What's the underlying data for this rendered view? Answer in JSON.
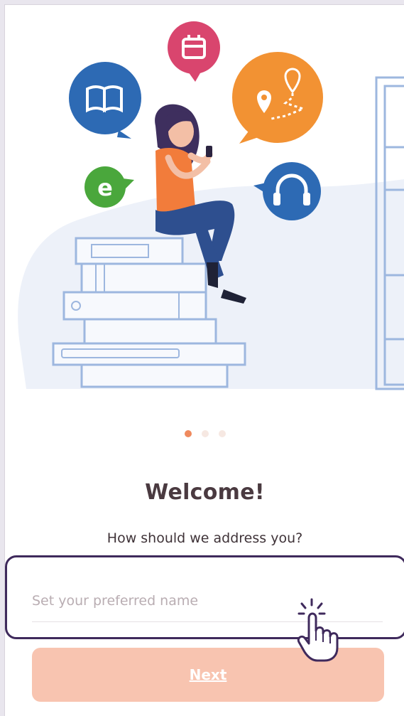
{
  "onboarding": {
    "title": "Welcome!",
    "subtitle": "How should we address you?",
    "page_indicator": {
      "current": 1,
      "total": 3
    }
  },
  "name_input": {
    "value": "",
    "placeholder": "Set your preferred name"
  },
  "next_button": {
    "label": "Next"
  },
  "colors": {
    "accent": "#ef8a5e",
    "button_bg": "#f8c4b0",
    "title_text": "#4a3a40",
    "highlight_border": "#3f2a5c"
  },
  "icons": [
    "book-bubble-icon",
    "calendar-bubble-icon",
    "map-route-bubble-icon",
    "ebook-bubble-icon",
    "headphones-bubble-icon",
    "hand-pointer-icon"
  ]
}
